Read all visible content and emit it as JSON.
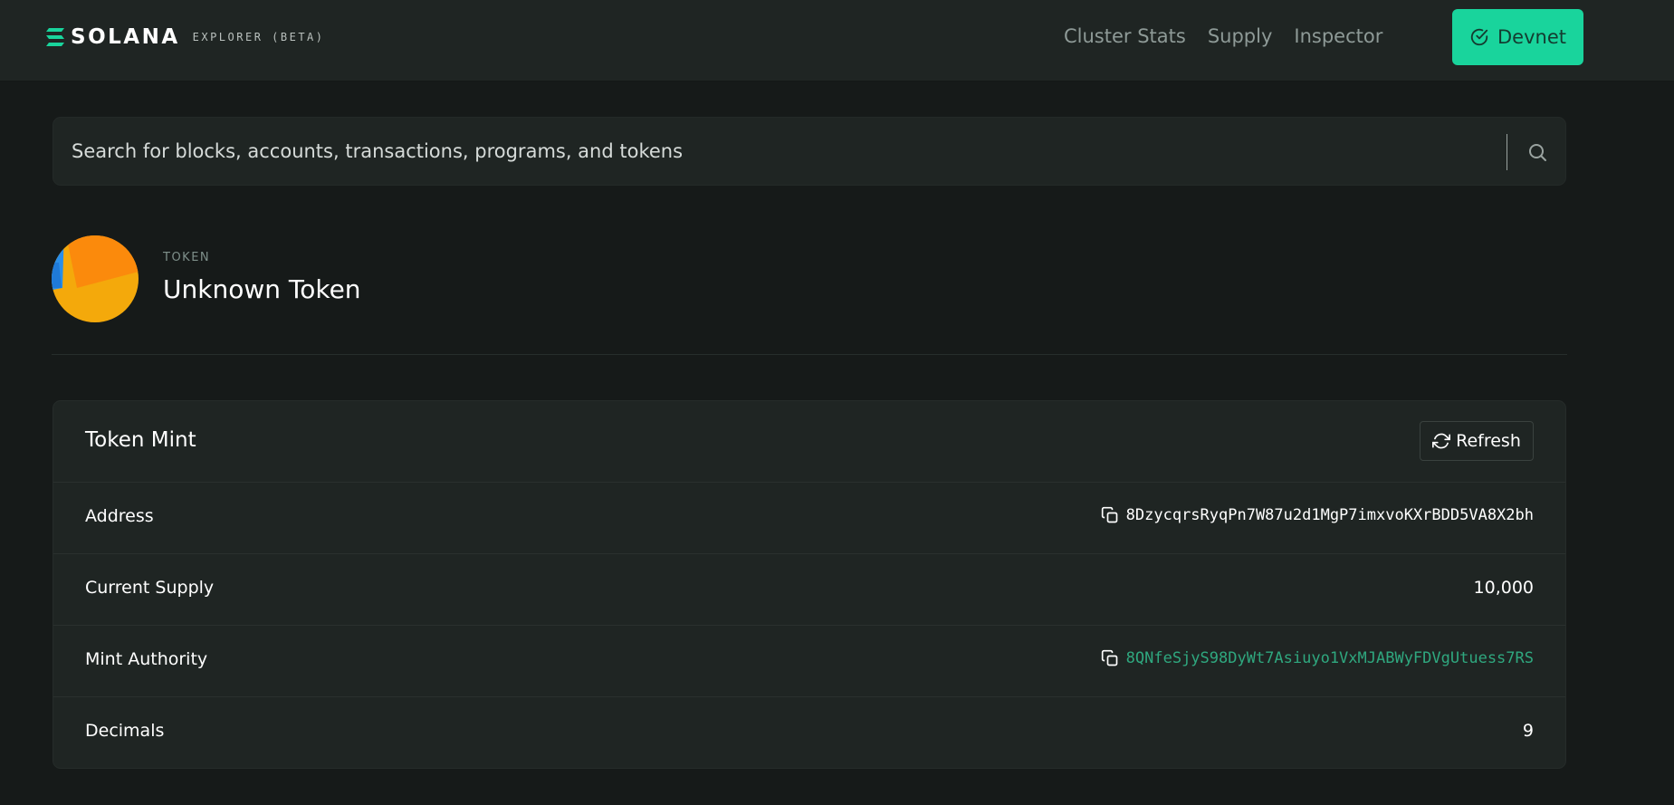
{
  "brand": {
    "name": "SOLANA",
    "subtitle": "EXPLORER (BETA)",
    "accent": "#19d49c"
  },
  "nav": {
    "links": [
      "Cluster Stats",
      "Supply",
      "Inspector"
    ],
    "cluster_button": {
      "label": "Devnet",
      "icon": "check-circle-icon"
    }
  },
  "search": {
    "placeholder": "Search for blocks, accounts, transactions, programs, and tokens",
    "value": "",
    "icon": "search-icon"
  },
  "token": {
    "label": "TOKEN",
    "name": "Unknown Token"
  },
  "card": {
    "title": "Token Mint",
    "refresh_label": "Refresh",
    "rows": [
      {
        "label": "Address",
        "value": "8DzycqrsRyqPn7W87u2d1MgP7imxvoKXrBDD5VA8X2bh",
        "copyable": true,
        "link": false
      },
      {
        "label": "Current Supply",
        "value": "10,000",
        "copyable": false,
        "link": false
      },
      {
        "label": "Mint Authority",
        "value": "8QNfeSjyS98DyWt7Asiuyo1VxMJABWyFDVgUtuess7RS",
        "copyable": true,
        "link": true
      },
      {
        "label": "Decimals",
        "value": "9",
        "copyable": false,
        "link": false
      }
    ]
  },
  "colors": {
    "background": "#161a19",
    "surface": "#1f2523",
    "link": "#2fa87f",
    "muted": "#8e9a97"
  }
}
